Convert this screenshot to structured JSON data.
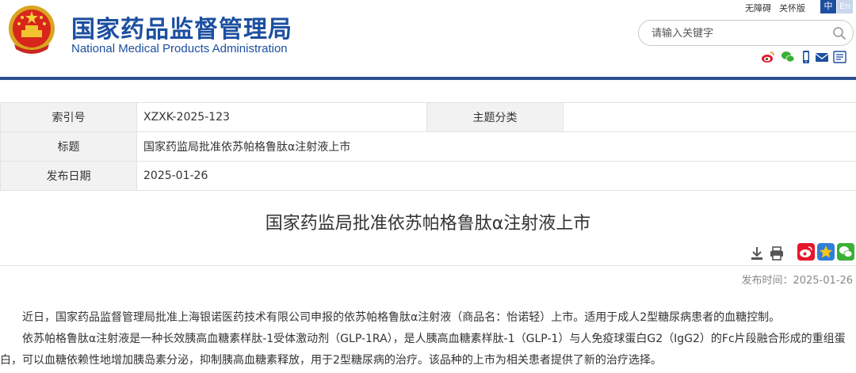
{
  "site": {
    "name_cn": "国家药品监督管理局",
    "name_en": "National Medical Products Administration"
  },
  "utility_links": [
    "无障碍",
    "关怀版"
  ],
  "lang": {
    "zh": "中",
    "en": "En"
  },
  "search": {
    "placeholder": "请输入关键字"
  },
  "header_share_icons": [
    "weibo-icon",
    "wechat-icon",
    "mobile-icon",
    "mail-icon",
    "rss-icon"
  ],
  "info": {
    "index_label": "索引号",
    "index_value": "XZXK-2025-123",
    "category_label": "主题分类",
    "category_value": "",
    "title_label": "标题",
    "title_value": "国家药监局批准依苏帕格鲁肽α注射液上市",
    "date_label": "发布日期",
    "date_value": "2025-01-26"
  },
  "article": {
    "title": "国家药监局批准依苏帕格鲁肽α注射液上市",
    "publish_time": "发布时间：2025-01-26",
    "paragraphs": [
      "近日，国家药品监督管理局批准上海银诺医药技术有限公司申报的依苏帕格鲁肽α注射液（商品名：怡诺轻）上市。适用于成人2型糖尿病患者的血糖控制。",
      "依苏帕格鲁肽α注射液是一种长效胰高血糖素样肽-1受体激动剂（GLP-1RA），是人胰高血糖素样肽-1（GLP-1）与人免疫球蛋白G2（IgG2）的Fc片段融合形成的重组蛋白，可以血糖依赖性地增加胰岛素分泌，抑制胰高血糖素释放，用于2型糖尿病的治疗。该品种的上市为相关患者提供了新的治疗选择。"
    ]
  },
  "colors": {
    "brand_blue": "#1c4fa0",
    "nav_line": "#2c4f8e",
    "weibo_red": "#e6162d",
    "wechat_green": "#3ab035",
    "star_blue": "#2f7fd8"
  }
}
